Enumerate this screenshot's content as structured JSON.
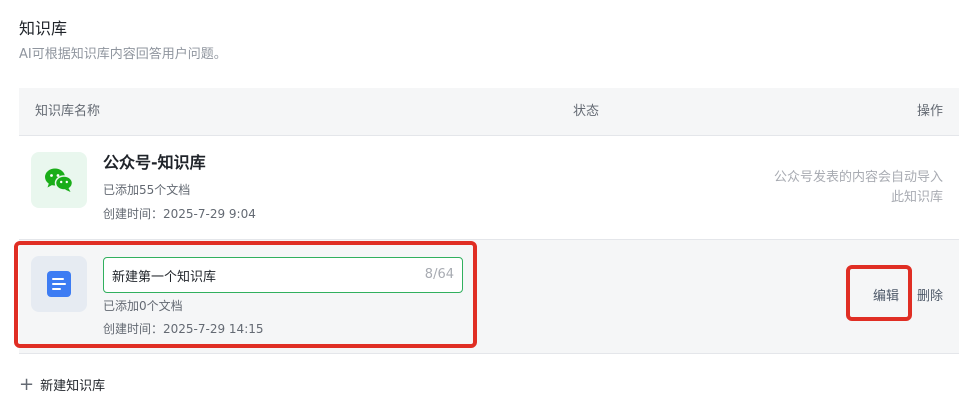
{
  "header": {
    "title": "知识库",
    "subtitle": "AI可根据知识库内容回答用户问题。"
  },
  "table": {
    "columns": {
      "name": "知识库名称",
      "status": "状态",
      "action": "操作"
    },
    "rows": [
      {
        "icon": "wechat-icon",
        "title": "公众号-知识库",
        "docs": "已添加55个文档",
        "created": "创建时间：2025-7-29 9:04",
        "note_line1": "公众号发表的内容会自动导入",
        "note_line2": "此知识库"
      },
      {
        "icon": "document-icon",
        "name_value": "新建第一个知识库",
        "char_count": "8/64",
        "docs": "已添加0个文档",
        "created": "创建时间：2025-7-29 14:15",
        "edit_label": "编辑",
        "delete_label": "删除"
      }
    ]
  },
  "new_kb_label": "新建知识库",
  "colors": {
    "accent_green": "#31b05e",
    "highlight_red": "#e02e24",
    "doc_blue": "#3d7cf3",
    "wechat_green": "#1aad19"
  }
}
